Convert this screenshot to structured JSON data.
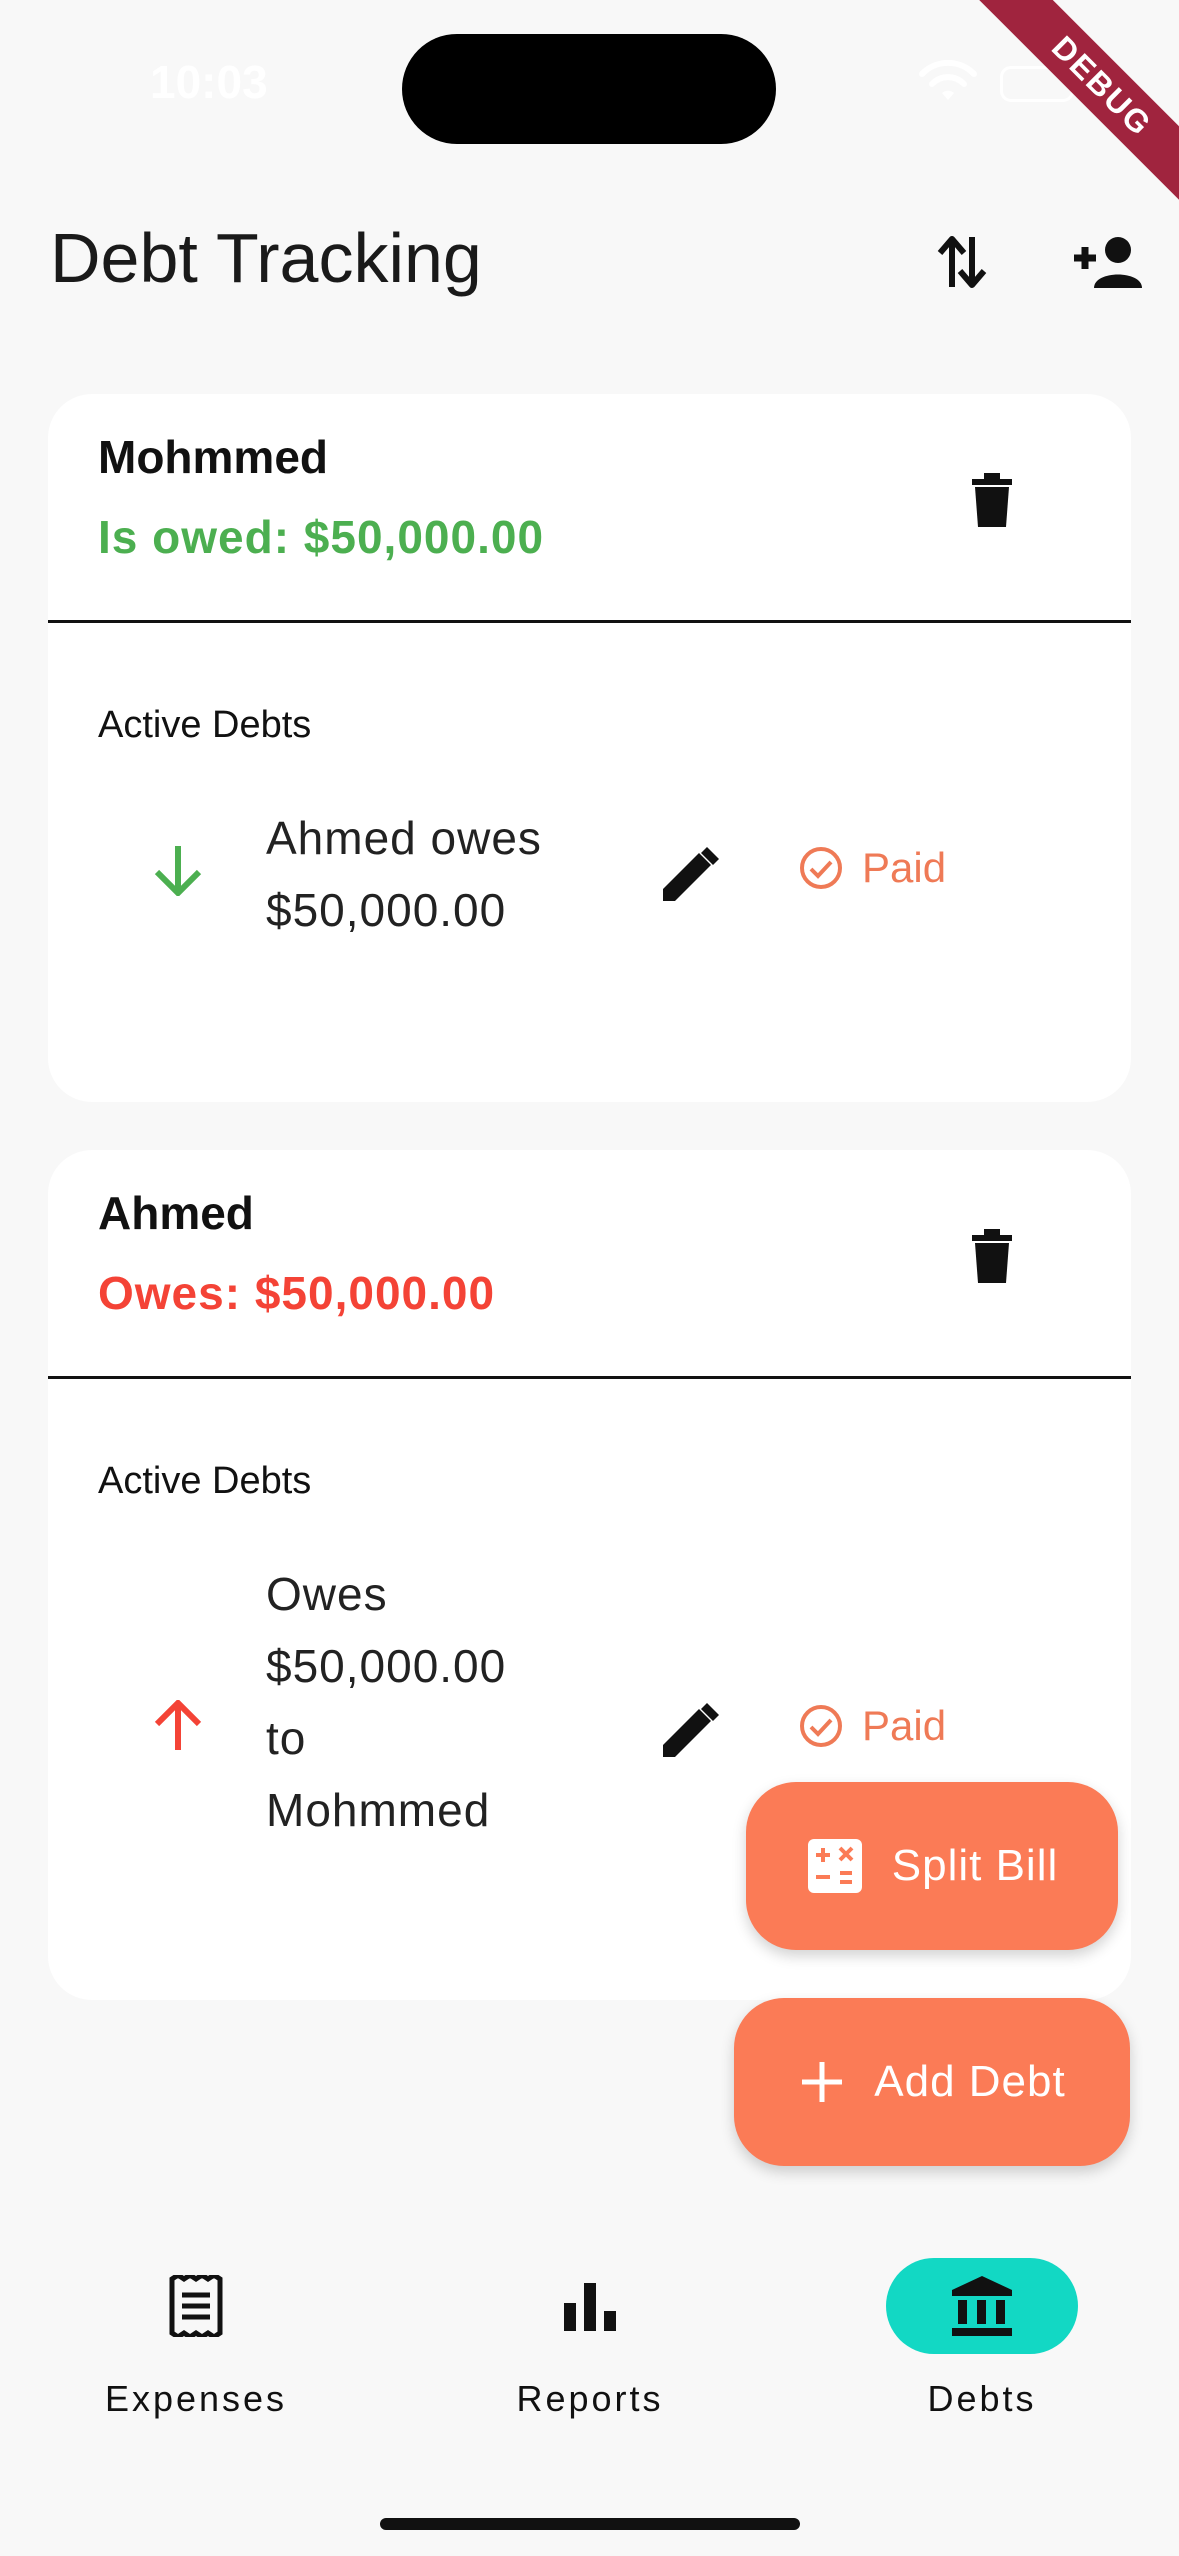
{
  "status": {
    "time": "10:03",
    "debug_label": "DEBUG"
  },
  "header": {
    "title": "Debt Tracking"
  },
  "cards": [
    {
      "name": "Mohmmed",
      "total": "Is owed: $50,000.00",
      "total_color": "#4caf50",
      "section_label": "Active Debts",
      "debt_lines": [
        "Ahmed owes",
        "$50,000.00"
      ],
      "direction_icon": "arrow-down-icon",
      "direction_color": "#4caf50",
      "paid_label": "Paid"
    },
    {
      "name": "Ahmed",
      "total": "Owes: $50,000.00",
      "total_color": "#f44336",
      "section_label": "Active Debts",
      "debt_lines": [
        "Owes",
        "$50,000.00",
        "to",
        "Mohmmed"
      ],
      "direction_icon": "arrow-up-icon",
      "direction_color": "#f44336",
      "paid_label": "Paid"
    }
  ],
  "fabs": {
    "split_bill": "Split Bill",
    "add_debt": "Add Debt"
  },
  "nav": {
    "items": [
      {
        "label": "Expenses",
        "icon": "receipt-icon",
        "active": false
      },
      {
        "label": "Reports",
        "icon": "bar-chart-icon",
        "active": false
      },
      {
        "label": "Debts",
        "icon": "bank-icon",
        "active": true
      }
    ]
  },
  "colors": {
    "accent": "#fb7b56",
    "active_nav": "#12d8c4",
    "owed_green": "#4caf50",
    "owes_red": "#f44336"
  }
}
